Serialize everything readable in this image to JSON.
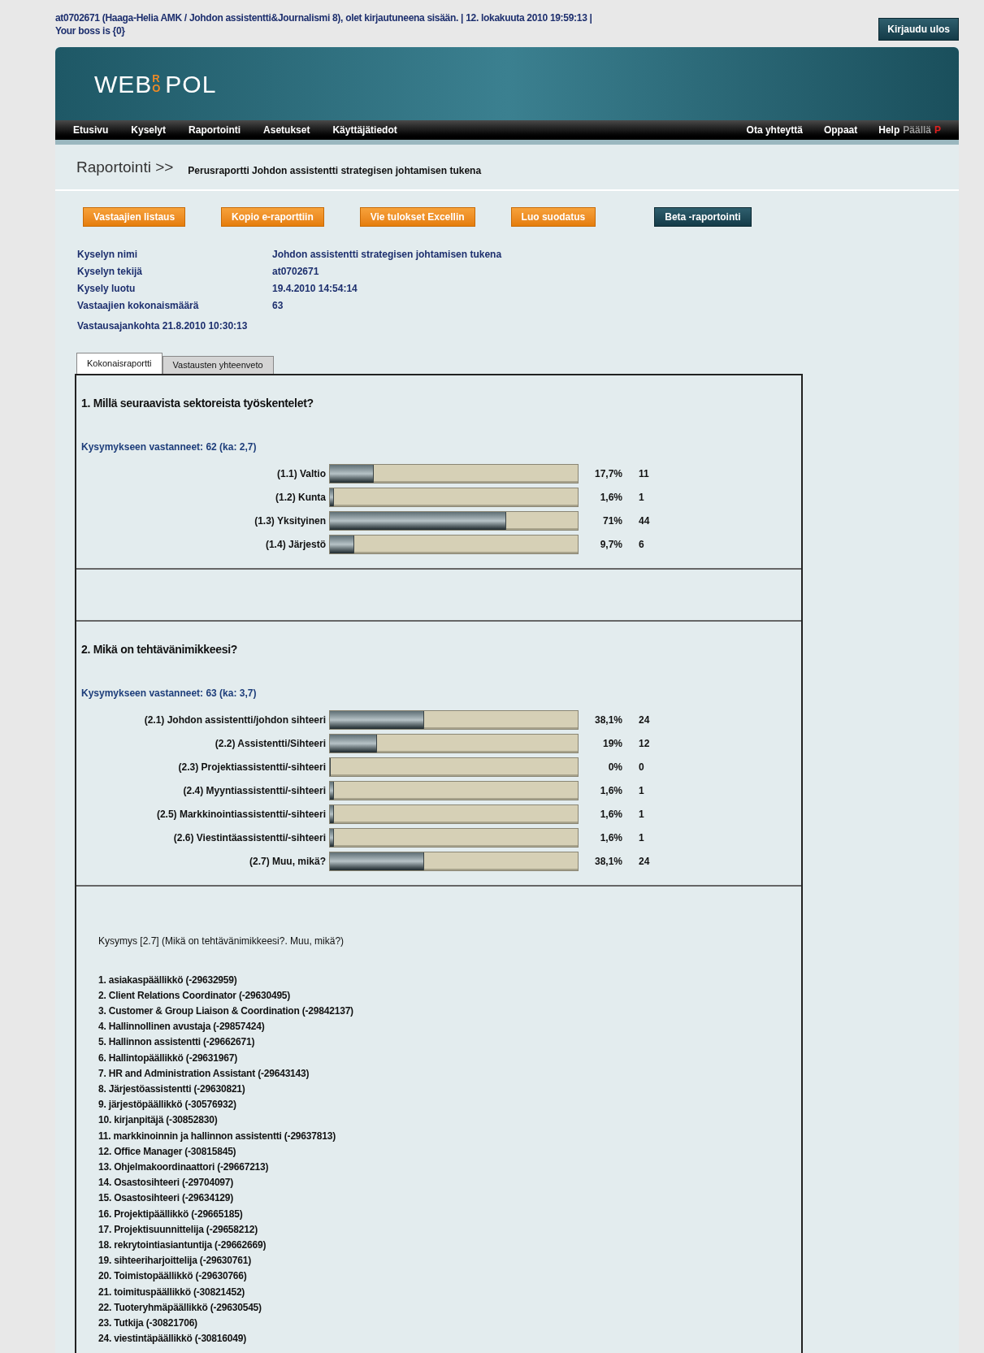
{
  "header": {
    "login_text": "at0702671 (Haaga-Helia AMK / Johdon assistentti&Journalismi 8), olet kirjautuneena sisään. | 12. lokakuuta 2010 19:59:13 |",
    "boss_text": "Your boss is {0}",
    "logout_button": "Kirjaudu ulos"
  },
  "logo": {
    "left": "WEB",
    "mark": "RO",
    "right": "POL"
  },
  "nav": {
    "left": [
      {
        "label": "Etusivu",
        "kind": "link"
      },
      {
        "label": "Kyselyt",
        "kind": "link"
      },
      {
        "label": "Raportointi",
        "kind": "link"
      },
      {
        "label": "Asetukset",
        "kind": "link"
      },
      {
        "label": "Käyttäjätiedot",
        "kind": "link"
      }
    ],
    "right": [
      {
        "label": "Ota yhteyttä",
        "kind": "link"
      },
      {
        "label": "Oppaat",
        "kind": "link"
      },
      {
        "label": "Help",
        "kind": "link"
      },
      {
        "label": "Päällä",
        "kind": "muted"
      },
      {
        "label": "P",
        "kind": "alert"
      }
    ]
  },
  "breadcrumb": {
    "section": "Raportointi >>",
    "title": "Perusraportti Johdon assistentti strategisen johtamisen tukena"
  },
  "actions": [
    {
      "label": "Vastaajien listaus",
      "kind": "orange"
    },
    {
      "label": "Kopio e-raporttiin",
      "kind": "orange"
    },
    {
      "label": "Vie tulokset ExcelIin",
      "kind": "orange"
    },
    {
      "label": "Luo suodatus",
      "kind": "orange"
    },
    {
      "label": "Beta -raportointi",
      "kind": "dark"
    }
  ],
  "info": [
    {
      "label": "Kyselyn nimi",
      "value": "Johdon assistentti strategisen johtamisen tukena"
    },
    {
      "label": "Kyselyn tekijä",
      "value": "at0702671"
    },
    {
      "label": "Kysely luotu",
      "value": "19.4.2010 14:54:14"
    },
    {
      "label": "Vastaajien kokonaismäärä",
      "value": "63"
    }
  ],
  "response_time": "Vastausajankohta 21.8.2010 10:30:13",
  "tabs": [
    {
      "label": "Kokonaisraportti",
      "selected": true
    },
    {
      "label": "Vastausten yhteenveto",
      "selected": false
    }
  ],
  "questions": [
    {
      "title": "1. Millä seuraavista sektoreista työskentelet?",
      "answered": "Kysymykseen vastanneet: 62 (ka: 2,7)",
      "options": [
        {
          "label": "(1.1) Valtio",
          "level": 0.177,
          "percent": "17,7%",
          "count": "11"
        },
        {
          "label": "(1.2) Kunta",
          "level": 0.016,
          "percent": "1,6%",
          "count": "1"
        },
        {
          "label": "(1.3) Yksityinen",
          "level": 0.71,
          "percent": "71%",
          "count": "44"
        },
        {
          "label": "(1.4) Järjestö",
          "level": 0.097,
          "percent": "9,7%",
          "count": "6"
        }
      ]
    },
    {
      "title": "2. Mikä on tehtävänimikkeesi?",
      "answered": "Kysymykseen vastanneet: 63 (ka: 3,7)",
      "options": [
        {
          "label": "(2.1) Johdon assistentti/johdon sihteeri",
          "level": 0.381,
          "percent": "38,1%",
          "count": "24"
        },
        {
          "label": "(2.2) Assistentti/Sihteeri",
          "level": 0.19,
          "percent": "19%",
          "count": "12"
        },
        {
          "label": "(2.3) Projektiassistentti/-sihteeri",
          "level": 0,
          "percent": "0%",
          "count": "0"
        },
        {
          "label": "(2.4) Myyntiassistentti/-sihteeri",
          "level": 0.016,
          "percent": "1,6%",
          "count": "1"
        },
        {
          "label": "(2.5) Markkinointiassistentti/-sihteeri",
          "level": 0.016,
          "percent": "1,6%",
          "count": "1"
        },
        {
          "label": "(2.6) Viestintäassistentti/-sihteeri",
          "level": 0.016,
          "percent": "1,6%",
          "count": "1"
        },
        {
          "label": "(2.7) Muu, mikä?",
          "level": 0.381,
          "percent": "38,1%",
          "count": "24"
        }
      ]
    }
  ],
  "open_answers": {
    "heading": "Kysymys [2.7] (Mikä on tehtävänimikkeesi?. Muu, mikä?)",
    "items": [
      "1. asiakaspäällikkö (-29632959)",
      "2. Client Relations Coordinator (-29630495)",
      "3. Customer & Group Liaison & Coordination (-29842137)",
      "4. Hallinnollinen avustaja (-29857424)",
      "5. Hallinnon assistentti (-29662671)",
      "6. Hallintopäällikkö (-29631967)",
      "7. HR and Administration Assistant (-29643143)",
      "8. Järjestöassistentti (-29630821)",
      "9. järjestöpäällikkö (-30576932)",
      "10. kirjanpitäjä (-30852830)",
      "11. markkinoinnin ja hallinnon assistentti (-29637813)",
      "12. Office Manager (-30815845)",
      "13. Ohjelmakoordinaattori (-29667213)",
      "14. Osastosihteeri (-29704097)",
      "15. Osastosihteeri (-29634129)",
      "16. Projektipäällikkö (-29665185)",
      "17. Projektisuunnittelija (-29658212)",
      "18. rekrytointiasiantuntija (-29662669)",
      "19. sihteeriharjoittelija (-29630761)",
      "20. Toimistopäällikkö (-29630766)",
      "21. toimituspäällikkö (-30821452)",
      "22. Tuoteryhmäpäällikkö (-29630545)",
      "23. Tutkija (-30821706)",
      "24. viestintäpäällikkö (-30816049)"
    ]
  }
}
